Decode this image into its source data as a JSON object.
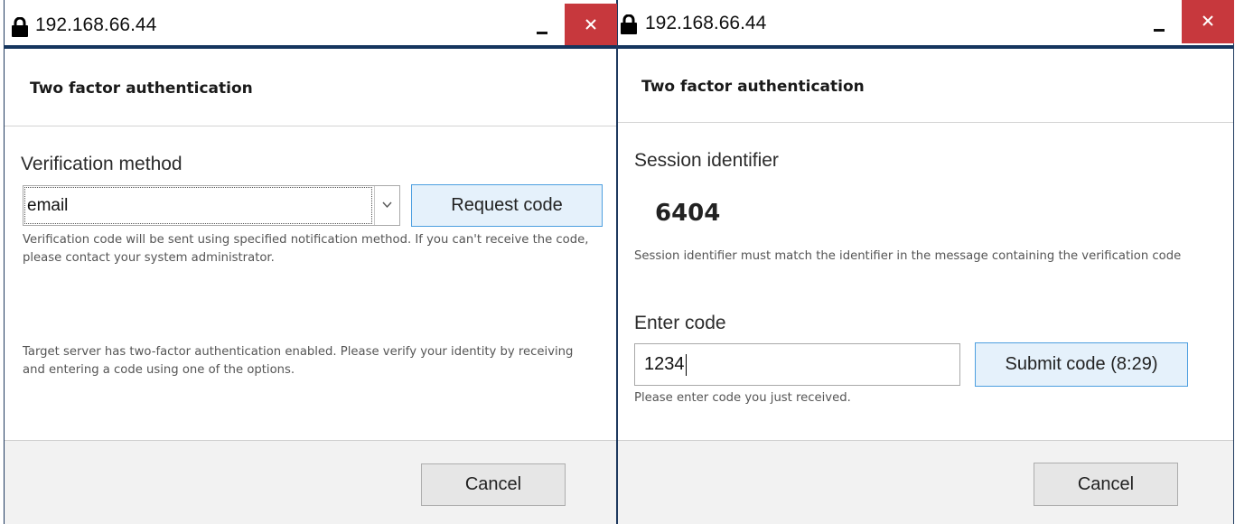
{
  "window_title": "192.168.66.44",
  "header_title": "Two factor authentication",
  "request_dialog": {
    "verification_label": "Verification method",
    "method_value": "email",
    "request_button": "Request code",
    "method_help": "Verification code will be sent using specified notification method. If you can't receive the code, please contact your system administrator.",
    "server_info": "Target server has two-factor authentication enabled. Please verify your identity by receiving and entering a code using one of the options.",
    "cancel_button": "Cancel"
  },
  "submit_dialog": {
    "session_label": "Session identifier",
    "session_id": "6404",
    "session_help": "Session identifier must match the identifier in the message containing the verification code",
    "enter_code_label": "Enter code",
    "code_value": "1234",
    "submit_button": "Submit code (8:29)",
    "code_help": "Please enter code you just received.",
    "cancel_button": "Cancel"
  },
  "icons": {
    "lock": "lock-icon",
    "minimize": "minimize-icon",
    "close": "close-icon",
    "dropdown": "chevron-down-icon"
  },
  "colors": {
    "titlebar_border": "#15355e",
    "close_button": "#c7383d",
    "primary_button_border": "#4d9fe0",
    "footer_bg": "#f2f2f2"
  }
}
